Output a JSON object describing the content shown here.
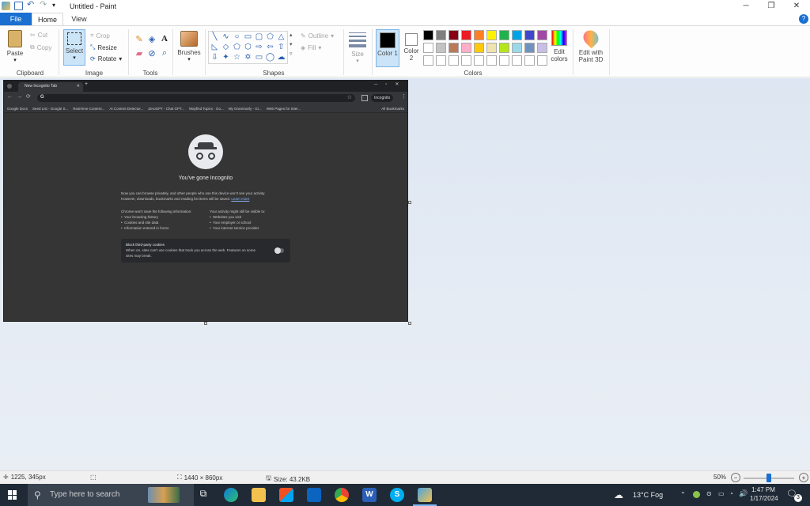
{
  "window": {
    "title": "Untitled - Paint"
  },
  "menu": {
    "file": "File",
    "home": "Home",
    "view": "View"
  },
  "clipboard": {
    "paste": "Paste",
    "cut": "Cut",
    "copy": "Copy",
    "label": "Clipboard"
  },
  "image": {
    "select": "Select",
    "crop": "Crop",
    "resize": "Resize",
    "rotate": "Rotate",
    "label": "Image"
  },
  "tools": {
    "label": "Tools"
  },
  "brushes": {
    "label": "Brushes"
  },
  "shapes": {
    "outline": "Outline",
    "fill": "Fill",
    "label": "Shapes"
  },
  "size": {
    "label": "Size"
  },
  "colors": {
    "color1": "Color 1",
    "color2": "Color 2",
    "edit": "Edit colors",
    "label": "Colors",
    "color1_value": "#000000",
    "color2_value": "#ffffff",
    "palette_row1": [
      "#000000",
      "#7f7f7f",
      "#880015",
      "#ed1c24",
      "#ff7f27",
      "#fff200",
      "#22b14c",
      "#00a2e8",
      "#3f48cc",
      "#a349a4"
    ],
    "palette_row2": [
      "#ffffff",
      "#c3c3c3",
      "#b97a57",
      "#ffaec9",
      "#ffc90e",
      "#efe4b0",
      "#b5e61d",
      "#99d9ea",
      "#7092be",
      "#c8bfe7"
    ]
  },
  "paint3d": {
    "label": "Edit with Paint 3D"
  },
  "browser": {
    "tab_title": "New Incognito Tab",
    "incognito_badge": "Incognito",
    "bookmarks": [
      "Google Docs",
      "Seed List - Google S...",
      "Real-time Content...",
      "AI Content Detector...",
      "ZeroGPT - Chat GPT...",
      "Wayfind Topics - Go...",
      "My Grammarly - Gr...",
      "Web Pages for Inter..."
    ],
    "all_bookmarks": "All Bookmarks",
    "heading": "You've gone Incognito",
    "intro1": "Now you can browse privately, and other people who use this device won't see your activity.",
    "intro2": "However, downloads, bookmarks and reading list items will be saved.",
    "learn_more": "Learn more",
    "left_title": "Chrome won't save the following information:",
    "left_items": [
      "Your browsing history",
      "Cookies and site data",
      "Information entered in forms"
    ],
    "right_title": "Your activity might still be visible to:",
    "right_items": [
      "Websites you visit",
      "Your employer or school",
      "Your internet service provider"
    ],
    "block_title": "Block third-party cookies",
    "block_text1": "When on, sites can't use cookies that track you across the web. Features on some",
    "block_text2": "sites may break."
  },
  "status": {
    "cursor": "1225, 345px",
    "dimensions": "1440 × 860px",
    "size": "Size: 43.2KB",
    "zoom": "50%",
    "zoom_level": 0.5
  },
  "taskbar": {
    "search_placeholder": "Type here to search",
    "weather": "13°C  Fog",
    "time": "1:47 PM",
    "date": "1/17/2024",
    "notifications": "3"
  }
}
